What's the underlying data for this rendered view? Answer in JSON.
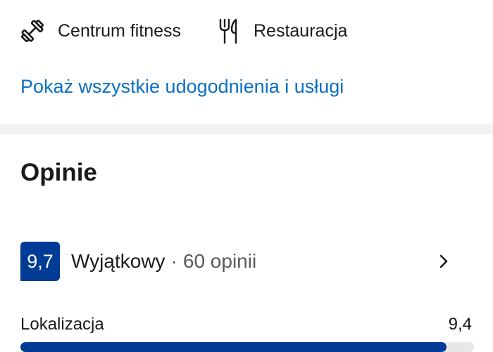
{
  "amenities": [
    {
      "label": "Centrum fitness",
      "icon": "dumbbell-icon"
    },
    {
      "label": "Restauracja",
      "icon": "fork-knife-icon"
    }
  ],
  "show_all_link": "Pokaż wszystkie udogodnienia i usługi",
  "reviews": {
    "title": "Opinie",
    "score": "9,7",
    "rating_word": "Wyjątkowy",
    "separator": "·",
    "count": "60 opinii",
    "categories": [
      {
        "name": "Lokalizacja",
        "score": "9,4",
        "fill_fraction": 0.94
      }
    ]
  },
  "colors": {
    "link": "#0a6fc2",
    "badge": "#003b95",
    "bar_fill": "#003b95",
    "bar_track": "#e7e7e7",
    "divider": "#f2f2f2"
  }
}
